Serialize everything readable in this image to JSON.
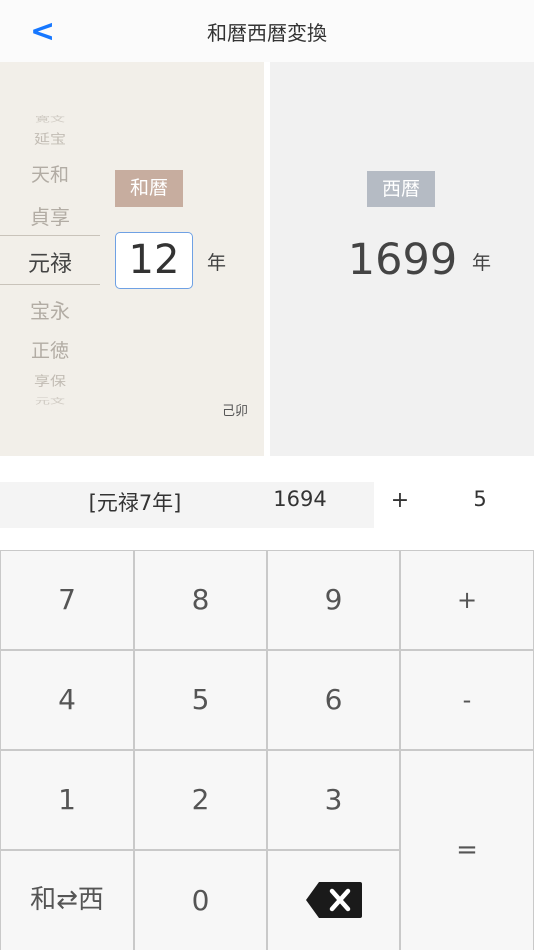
{
  "header": {
    "back_label": "<",
    "title": "和暦西暦変換"
  },
  "wareki": {
    "badge": "和暦",
    "era_list": [
      "寛文",
      "延宝",
      "天和",
      "貞享",
      "元禄",
      "宝永",
      "正徳",
      "享保",
      "元文"
    ],
    "selected_era": "元禄",
    "year_value": "12",
    "nen": "年",
    "eto": "己卯"
  },
  "seireki": {
    "badge": "西暦",
    "year_value": "1699",
    "nen": "年"
  },
  "calc": {
    "era_label": "[元禄7年]",
    "base": "1694",
    "operator": "+",
    "offset": "5"
  },
  "keypad": {
    "k7": "7",
    "k8": "8",
    "k9": "9",
    "plus": "+",
    "k4": "4",
    "k5": "5",
    "k6": "6",
    "minus": "-",
    "k1": "1",
    "k2": "2",
    "k3": "3",
    "equals": "=",
    "toggle": "和⇄西",
    "k0": "0"
  },
  "icons": {
    "backspace": "backspace-icon"
  },
  "colors": {
    "accent_blue": "#1677ff",
    "wareki_badge": "#c7ad9f",
    "seireki_badge": "#b5bbc4",
    "left_panel_bg": "#f2efe9",
    "right_panel_bg": "#f1f1f1"
  }
}
